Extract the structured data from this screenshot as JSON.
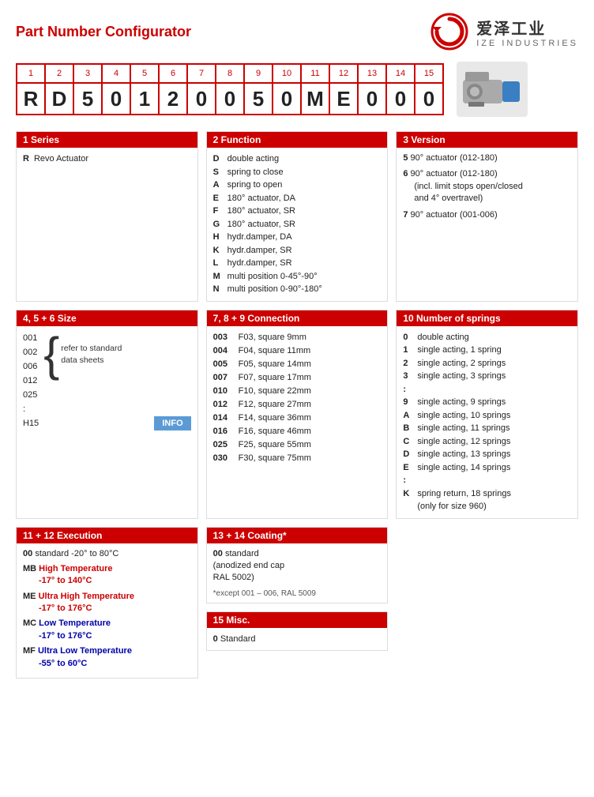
{
  "header": {
    "title": "Part Number Configurator",
    "brand_zh": "爱泽工业",
    "brand_en": "IZE INDUSTRIES"
  },
  "part_number": {
    "positions": [
      "1",
      "2",
      "3",
      "4",
      "5",
      "6",
      "7",
      "8",
      "9",
      "10",
      "11",
      "12",
      "13",
      "14",
      "15"
    ],
    "chars": [
      "R",
      "D",
      "5",
      "0",
      "1",
      "2",
      "0",
      "0",
      "5",
      "0",
      "M",
      "E",
      "0",
      "0",
      "0"
    ]
  },
  "section1": {
    "header": "1  Series",
    "rows": [
      {
        "code": "R",
        "desc": "Revo Actuator"
      }
    ]
  },
  "section2": {
    "header": "2  Function",
    "rows": [
      {
        "code": "D",
        "desc": "double acting"
      },
      {
        "code": "S",
        "desc": "spring to close"
      },
      {
        "code": "A",
        "desc": "spring to open"
      },
      {
        "code": "E",
        "desc": "180° actuator, DA"
      },
      {
        "code": "F",
        "desc": "180° actuator, SR"
      },
      {
        "code": "G",
        "desc": "180° actuator, SR"
      },
      {
        "code": "H",
        "desc": "hydr.damper, DA"
      },
      {
        "code": "K",
        "desc": "hydr.damper, SR"
      },
      {
        "code": "L",
        "desc": "hydr.damper, SR"
      },
      {
        "code": "M",
        "desc": "multi position 0-45°-90°"
      },
      {
        "code": "N",
        "desc": "multi position 0-90°-180°"
      }
    ]
  },
  "section3": {
    "header": "3  Version",
    "items": [
      {
        "num": "5",
        "desc": "90° actuator (012-180)"
      },
      {
        "num": "6",
        "desc": "90° actuator (012-180)\n(incl. limit stops open/closed\nand 4° overtravel)"
      },
      {
        "num": "7",
        "desc": "90° actuator (001-006)"
      }
    ]
  },
  "section456": {
    "header": "4, 5 + 6  Size",
    "sizes": [
      "001",
      "002",
      "006",
      "012",
      "025",
      ":",
      "H15"
    ],
    "refer_text": "refer to standard\ndata sheets",
    "info_label": "INFO"
  },
  "section789": {
    "header": "7, 8 + 9  Connection",
    "rows": [
      {
        "code": "003",
        "desc": "F03, square 9mm"
      },
      {
        "code": "004",
        "desc": "F04, square 11mm"
      },
      {
        "code": "005",
        "desc": "F05, square 14mm"
      },
      {
        "code": "007",
        "desc": "F07, square 17mm"
      },
      {
        "code": "010",
        "desc": "F10, square 22mm"
      },
      {
        "code": "012",
        "desc": "F12, square 27mm"
      },
      {
        "code": "014",
        "desc": "F14, square 36mm"
      },
      {
        "code": "016",
        "desc": "F16, square 46mm"
      },
      {
        "code": "025",
        "desc": "F25, square 55mm"
      },
      {
        "code": "030",
        "desc": "F30, square 75mm"
      }
    ]
  },
  "section10": {
    "header": "10  Number of springs",
    "rows": [
      {
        "code": "0",
        "desc": "double acting"
      },
      {
        "code": "1",
        "desc": "single acting, 1 spring"
      },
      {
        "code": "2",
        "desc": "single acting, 2 springs"
      },
      {
        "code": "3",
        "desc": "single acting, 3 springs"
      },
      {
        "code": ":",
        "desc": ""
      },
      {
        "code": "9",
        "desc": "single acting, 9 springs"
      },
      {
        "code": "A",
        "desc": "single acting, 10 springs"
      },
      {
        "code": "B",
        "desc": "single acting, 11 springs"
      },
      {
        "code": "C",
        "desc": "single acting, 12 springs"
      },
      {
        "code": "D",
        "desc": "single acting, 13 springs"
      },
      {
        "code": "E",
        "desc": "single acting, 14 springs"
      },
      {
        "code": ":",
        "desc": ""
      },
      {
        "code": "K",
        "desc": "spring return, 18 springs\n(only for size 960)"
      }
    ]
  },
  "section1112": {
    "header": "11 + 12  Execution",
    "items": [
      {
        "code": "00",
        "desc": "standard  -20° to 80°C",
        "style": "normal"
      },
      {
        "code": "MB",
        "desc": "High Temperature\n -17° to 140°C",
        "style": "red"
      },
      {
        "code": "ME",
        "desc": "Ultra High Temperature\n -17° to 176°C",
        "style": "red"
      },
      {
        "code": "MC",
        "desc": "Low Temperature\n -17° to 176°C",
        "style": "blue"
      },
      {
        "code": "MF",
        "desc": "Ultra Low Temperature\n -55° to 60°C",
        "style": "blue"
      }
    ]
  },
  "section1314": {
    "header": "13 + 14  Coating*",
    "items": [
      {
        "code": "00",
        "desc": "standard\n(anodized end cap\nRAL 5002)"
      }
    ],
    "note": "*except 001 – 006, RAL 5009"
  },
  "section15": {
    "header": "15  Misc.",
    "items": [
      {
        "code": "0",
        "desc": "Standard"
      }
    ]
  }
}
